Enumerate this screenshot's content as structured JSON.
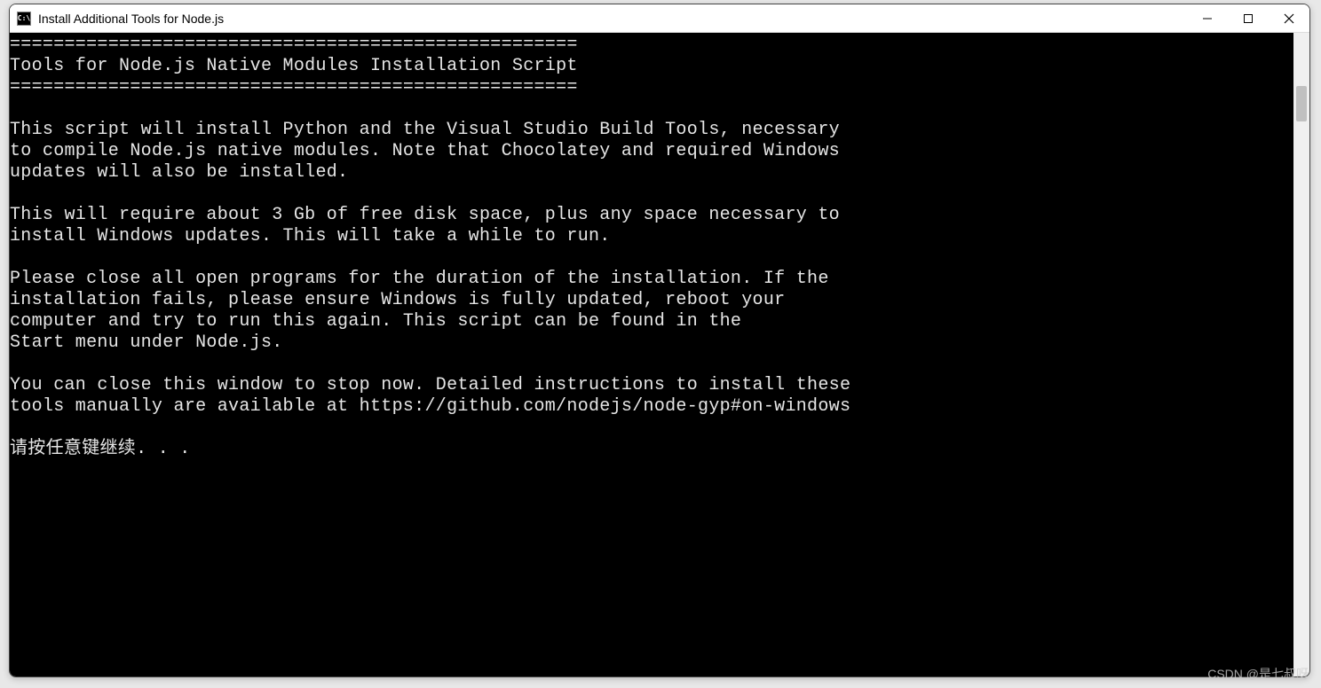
{
  "window": {
    "title": "Install Additional Tools for Node.js",
    "icon_label": "C:\\"
  },
  "console": {
    "lines": [
      "====================================================",
      "Tools for Node.js Native Modules Installation Script",
      "====================================================",
      "",
      "This script will install Python and the Visual Studio Build Tools, necessary",
      "to compile Node.js native modules. Note that Chocolatey and required Windows",
      "updates will also be installed.",
      "",
      "This will require about 3 Gb of free disk space, plus any space necessary to",
      "install Windows updates. This will take a while to run.",
      "",
      "Please close all open programs for the duration of the installation. If the",
      "installation fails, please ensure Windows is fully updated, reboot your",
      "computer and try to run this again. This script can be found in the",
      "Start menu under Node.js.",
      "",
      "You can close this window to stop now. Detailed instructions to install these",
      "tools manually are available at https://github.com/nodejs/node-gyp#on-windows",
      "",
      "请按任意键继续. . ."
    ]
  },
  "watermark": "CSDN @是七叔呀"
}
